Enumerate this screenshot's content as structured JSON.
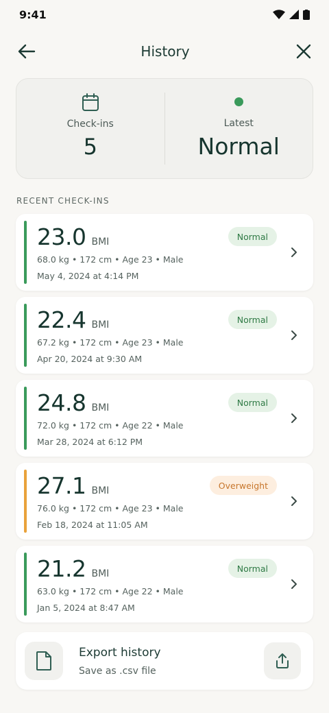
{
  "status_bar": {
    "time": "9:41"
  },
  "header": {
    "title": "History"
  },
  "summary": {
    "checkins_label": "Check-ins",
    "checkins_value": "5",
    "latest_label": "Latest",
    "latest_value": "Normal"
  },
  "section_title": "RECENT CHECK-INS",
  "checkins": [
    {
      "bmi": "23.0",
      "unit": "BMI",
      "status": "Normal",
      "meta": "68.0 kg • 172 cm • Age 23 • Male",
      "date": "May 4, 2024 at 4:14 PM"
    },
    {
      "bmi": "22.4",
      "unit": "BMI",
      "status": "Normal",
      "meta": "67.2 kg • 172 cm • Age 23 • Male",
      "date": "Apr 20, 2024 at 9:30 AM"
    },
    {
      "bmi": "24.8",
      "unit": "BMI",
      "status": "Normal",
      "meta": "72.0 kg • 172 cm • Age 22 • Male",
      "date": "Mar 28, 2024 at 6:12 PM"
    },
    {
      "bmi": "27.1",
      "unit": "BMI",
      "status": "Overweight",
      "meta": "76.0 kg • 172 cm • Age 23 • Male",
      "date": "Feb 18, 2024 at 11:05 AM"
    },
    {
      "bmi": "21.2",
      "unit": "BMI",
      "status": "Normal",
      "meta": "63.0 kg • 172 cm • Age 22 • Male",
      "date": "Jan 5, 2024 at 8:47 AM"
    }
  ],
  "export": {
    "title": "Export history",
    "subtitle": "Save as .csv file"
  },
  "colors": {
    "normal": "#3a9a5b",
    "overweight": "#e9a23b",
    "text_primary": "#16352e",
    "background": "#f8f7f4"
  }
}
